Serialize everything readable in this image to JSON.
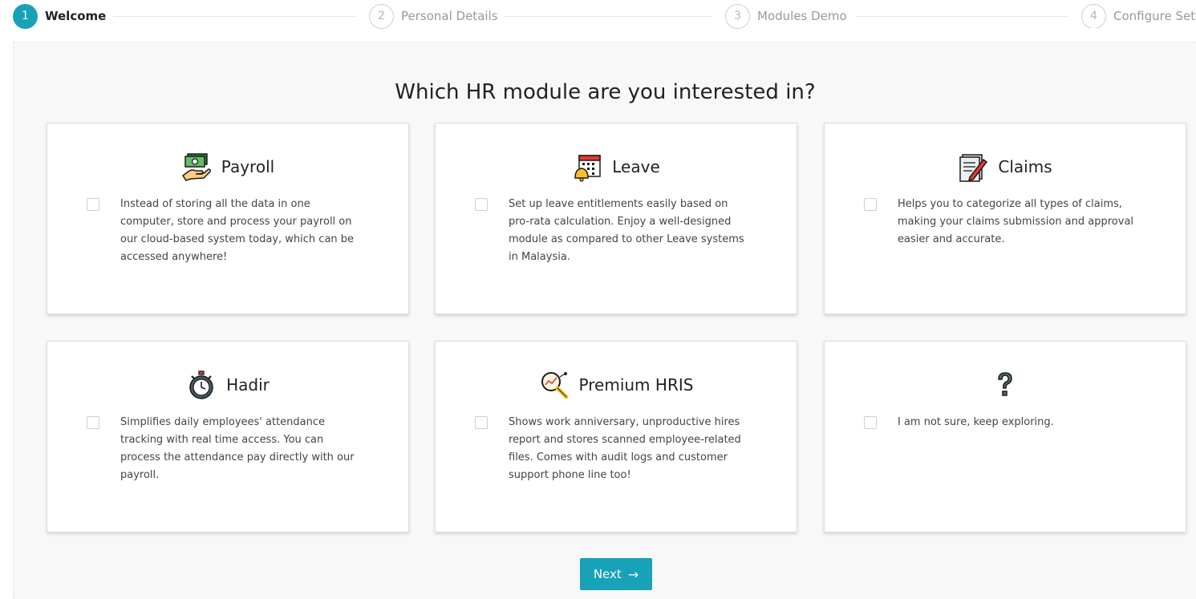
{
  "stepper": {
    "steps": [
      {
        "number": "1",
        "label": "Welcome"
      },
      {
        "number": "2",
        "label": "Personal Details"
      },
      {
        "number": "3",
        "label": "Modules Demo"
      },
      {
        "number": "4",
        "label": "Configure Sett"
      }
    ]
  },
  "main": {
    "title": "Which HR module are you interested in?",
    "cards": [
      {
        "title": "Payroll",
        "icon": "payroll-money-hand-icon",
        "description": "Instead of storing all the data in one computer, store and process your payroll on our cloud-based system today, which can be accessed anywhere!"
      },
      {
        "title": "Leave",
        "icon": "calendar-bell-icon",
        "description": "Set up leave entitlements easily based on pro-rata calculation. Enjoy a well-designed module as compared to other Leave systems in Malaysia."
      },
      {
        "title": "Claims",
        "icon": "document-pen-icon",
        "description": "Helps you to categorize all types of claims, making your claims submission and approval easier and accurate."
      },
      {
        "title": "Hadir",
        "icon": "stopwatch-icon",
        "description": "Simplifies daily employees' attendance tracking with real time access. You can process the attendance pay directly with our payroll."
      },
      {
        "title": "Premium HRIS",
        "icon": "magnifier-chart-icon",
        "description": "Shows work anniversary, unproductive hires report and stores scanned employee-related files. Comes with audit logs and customer support phone line too!"
      },
      {
        "title": "",
        "icon": "question-mark-icon",
        "description": "I am not sure, keep exploring."
      }
    ],
    "next_label": "Next"
  },
  "colors": {
    "accent": "#17a2b8",
    "background": "#f8f8f8"
  }
}
